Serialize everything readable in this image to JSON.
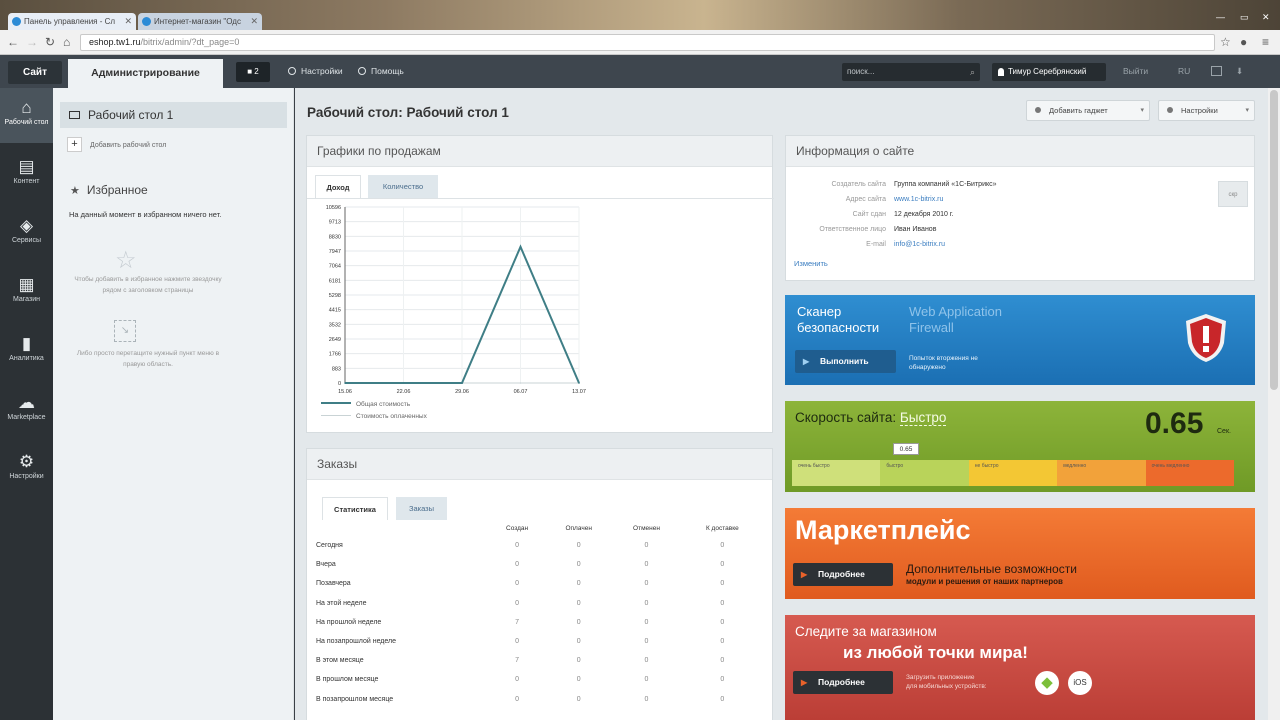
{
  "browser": {
    "tabs": [
      {
        "title": "Панель управления - Сл"
      },
      {
        "title": "Интернет-магазин \"Одс"
      }
    ],
    "url_host": "eshop.tw1.ru",
    "url_path": "/bitrix/admin/?dt_page=0"
  },
  "topbar": {
    "site_label": "Сайт",
    "admin_label": "Администрирование",
    "notifications": "2",
    "settings_label": "Настройки",
    "help_label": "Помощь",
    "search_placeholder": "поиск...",
    "user_name": "Тимур Серебрянский",
    "logout_label": "Выйти",
    "lang_label": "RU"
  },
  "iconbar": {
    "items": [
      {
        "label": "Рабочий стол",
        "icon": "home-icon"
      },
      {
        "label": "Контент",
        "icon": "document-icon"
      },
      {
        "label": "Сервисы",
        "icon": "layers-icon"
      },
      {
        "label": "Магазин",
        "icon": "basket-icon"
      },
      {
        "label": "Аналитика",
        "icon": "bar-chart-icon"
      },
      {
        "label": "Marketplace",
        "icon": "cloud-icon"
      },
      {
        "label": "Настройки",
        "icon": "gear-icon"
      }
    ]
  },
  "sidebar": {
    "desktop_item": "Рабочий стол 1",
    "add_desktop": "Добавить рабочий стол",
    "favorites_title": "Избранное",
    "favorites_empty": "На данный момент в избранном ничего нет.",
    "favorites_hint_star": "Чтобы добавить в избранное нажмите звездочку рядом с заголовком страницы",
    "favorites_hint_drag": "Либо просто перетащите нужный пункт меню в правую область."
  },
  "main": {
    "title": "Рабочий стол: Рабочий стол 1",
    "add_gadget": "Добавить гаджет",
    "settings": "Настройки"
  },
  "sales": {
    "title": "Графики по продажам",
    "tabs": [
      "Доход",
      "Количество"
    ],
    "legend": [
      "Общая стоимость",
      "Стоимость оплаченных"
    ],
    "y_ticks": [
      "10596",
      "9713",
      "8830",
      "7947",
      "7064",
      "6181",
      "5298",
      "4415",
      "3532",
      "2649",
      "1766",
      "883",
      "0"
    ],
    "x_ticks": [
      "15.06",
      "22.06",
      "29.06",
      "06.07",
      "13.07"
    ]
  },
  "chart_data": {
    "type": "line",
    "x": [
      "15.06",
      "22.06",
      "29.06",
      "06.07",
      "13.07"
    ],
    "series": [
      {
        "name": "Общая стоимость",
        "values": [
          0,
          0,
          0,
          8200,
          0
        ]
      },
      {
        "name": "Стоимость оплаченных",
        "values": [
          0,
          0,
          0,
          0,
          0
        ]
      }
    ],
    "ylim": [
      0,
      10596
    ],
    "grid": true,
    "legend": "bottom-left"
  },
  "orders": {
    "title": "Заказы",
    "tabs": [
      "Статистика",
      "Заказы"
    ],
    "columns": [
      "Создан",
      "Оплачен",
      "Отменен",
      "К доставке"
    ],
    "rows": [
      {
        "label": "Сегодня",
        "values": [
          "0",
          "0",
          "0",
          "0"
        ]
      },
      {
        "label": "Вчера",
        "values": [
          "0",
          "0",
          "0",
          "0"
        ]
      },
      {
        "label": "Позавчера",
        "values": [
          "0",
          "0",
          "0",
          "0"
        ]
      },
      {
        "label": "На этой неделе",
        "values": [
          "0",
          "0",
          "0",
          "0"
        ]
      },
      {
        "label": "На прошлой неделе",
        "values": [
          "7",
          "0",
          "0",
          "0"
        ]
      },
      {
        "label": "На позапрошлой неделе",
        "values": [
          "0",
          "0",
          "0",
          "0"
        ]
      },
      {
        "label": "В этом месяце",
        "values": [
          "7",
          "0",
          "0",
          "0"
        ]
      },
      {
        "label": "В прошлом месяце",
        "values": [
          "0",
          "0",
          "0",
          "0"
        ]
      },
      {
        "label": "В позапрошлом месяце",
        "values": [
          "0",
          "0",
          "0",
          "0"
        ]
      }
    ]
  },
  "info": {
    "title": "Информация о сайте",
    "hide": "скр",
    "rows": [
      {
        "k": "Создатель сайта",
        "v": "Группа компаний «1С-Битрикс»",
        "link": false
      },
      {
        "k": "Адрес сайта",
        "v": "www.1c-bitrix.ru",
        "link": true
      },
      {
        "k": "Сайт сдан",
        "v": "12 декабря 2010 г.",
        "link": false
      },
      {
        "k": "Ответственное лицо",
        "v": "Иван Иванов",
        "link": false
      },
      {
        "k": "E-mail",
        "v": "info@1c-bitrix.ru",
        "link": true
      }
    ],
    "edit": "Изменить"
  },
  "scanner": {
    "title_1": "Сканер",
    "title_2": "безопасности",
    "waf_1": "Web Application",
    "waf_2": "Firewall",
    "run": "Выполнить",
    "status_1": "Попыток вторжения не",
    "status_2": "обнаружено"
  },
  "speed": {
    "title": "Скорость сайта:",
    "status": "Быстро",
    "value": "0.65",
    "unit": "Сек.",
    "marker": "0.65",
    "segments": [
      "очень быстро",
      "быстро",
      "не быстро",
      "медленно",
      "очень медленно"
    ],
    "colors": [
      "#cfe07a",
      "#b9d35a",
      "#f3c734",
      "#f2a23a",
      "#ec6a2c"
    ]
  },
  "market": {
    "title": "Маркетплейс",
    "more": "Подробнее",
    "tagline": "Дополнительные возможности",
    "sub": "модули и решения от наших партнеров"
  },
  "mobile": {
    "line1": "Следите за магазином",
    "line2": "из любой точки мира!",
    "more": "Подробнее",
    "sub_1": "Загрузить приложение",
    "sub_2": "для мобильных устройств:",
    "ios": "iOS"
  }
}
